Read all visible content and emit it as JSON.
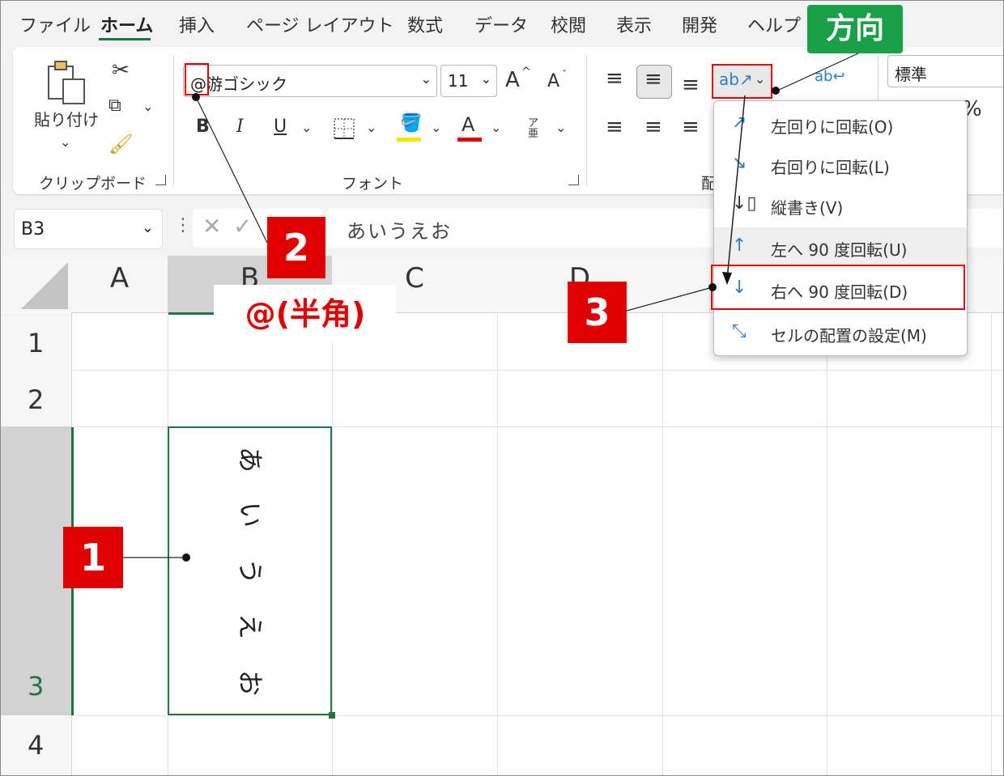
{
  "menu": {
    "tabs": [
      "ファイル",
      "ホーム",
      "挿入",
      "ページ レイアウト",
      "数式",
      "データ",
      "校閲",
      "表示",
      "開発",
      "ヘルプ"
    ],
    "active": "ホーム"
  },
  "ribbon": {
    "clipboard": {
      "paste_label": "貼り付け",
      "group_label": "クリップボード"
    },
    "font": {
      "font_name": "@游ゴシック",
      "font_size": "11",
      "bold": "B",
      "italic": "I",
      "underline": "U",
      "font_color_letter": "A",
      "phonetic": "ア亜",
      "grow": "A",
      "shrink": "A",
      "group_label": "フォント"
    },
    "alignment": {
      "group_label_partial": "配"
    },
    "number": {
      "format": "標準",
      "percent": "%"
    }
  },
  "formula_bar": {
    "name_box": "B3",
    "formula": "あいうえお"
  },
  "grid": {
    "columns": [
      "A",
      "B",
      "C",
      "D"
    ],
    "rows": [
      "1",
      "2",
      "3",
      "4"
    ],
    "cell_B3_chars": [
      "あ",
      "い",
      "う",
      "え",
      "お"
    ]
  },
  "orientation_menu": {
    "items": [
      {
        "label": "左回りに回転(O)",
        "icon": "rotate-ccw-icon"
      },
      {
        "label": "右回りに回転(L)",
        "icon": "rotate-cw-icon"
      },
      {
        "label": "縦書き(V)",
        "icon": "vertical-text-icon"
      },
      {
        "label": "左へ 90 度回転(U)",
        "icon": "rotate-up-icon"
      },
      {
        "label": "右へ 90 度回転(D)",
        "icon": "rotate-down-icon"
      },
      {
        "label": "セルの配置の設定(M)",
        "icon": "format-alignment-icon"
      }
    ]
  },
  "annotations": {
    "step1": "1",
    "step2": "2",
    "step3": "3",
    "direction": "方向",
    "halfwidth": "@(半角)"
  },
  "colors": {
    "accent_green": "#217346",
    "annotation_red": "#e00000",
    "direction_green": "#19a048"
  }
}
